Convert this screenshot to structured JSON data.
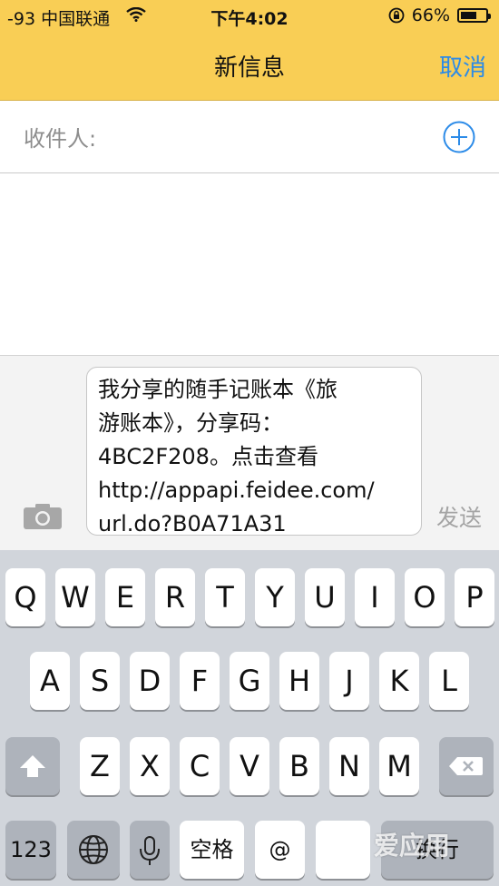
{
  "status": {
    "carrier": "-93 中国联通",
    "time": "下午4:02",
    "battery": "66%",
    "battery_level": 0.66
  },
  "nav": {
    "title": "新信息",
    "cancel_label": "取消"
  },
  "recipient": {
    "label": "收件人:"
  },
  "message": {
    "text": "我分享的随手记账本《旅\n游账本》，分享码：\n4BC2F208。点击查看\nhttp://appapi.feidee.com/\nurl.do?B0A71A31",
    "send_label": "发送"
  },
  "keyboard": {
    "row1": [
      "Q",
      "W",
      "E",
      "R",
      "T",
      "Y",
      "U",
      "I",
      "O",
      "P"
    ],
    "row2": [
      "A",
      "S",
      "D",
      "F",
      "G",
      "H",
      "J",
      "K",
      "L"
    ],
    "row3": [
      "Z",
      "X",
      "C",
      "V",
      "B",
      "N",
      "M"
    ],
    "numbers_label": "123",
    "space_label": "空格",
    "at_label": "@",
    "return_label": "换行"
  },
  "watermark": {
    "text": "爱应用"
  },
  "colors": {
    "nav_bg": "#f9ce55",
    "accent": "#2c8be8",
    "keyboard_bg": "#d1d5db"
  }
}
